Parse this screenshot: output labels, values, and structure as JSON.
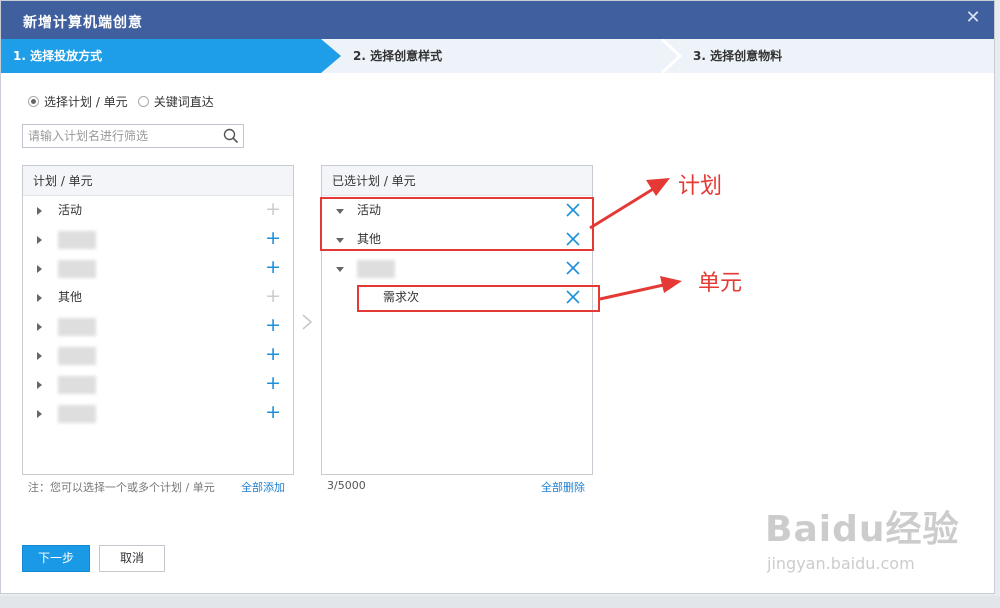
{
  "window": {
    "title": "新增计算机端创意"
  },
  "steps": [
    {
      "label": "1. 选择投放方式",
      "active": true
    },
    {
      "label": "2. 选择创意样式",
      "active": false
    },
    {
      "label": "3. 选择创意物料",
      "active": false
    }
  ],
  "mode": {
    "options": [
      {
        "label": "选择计划 / 单元",
        "selected": true
      },
      {
        "label": "关键词直达",
        "selected": false
      }
    ]
  },
  "search": {
    "placeholder": "请输入计划名进行筛选",
    "value": ""
  },
  "left_panel": {
    "header": "计划 / 单元",
    "items": [
      {
        "label": "活动",
        "blurred": false,
        "add_enabled": false
      },
      {
        "label": "",
        "blurred": true,
        "add_enabled": true
      },
      {
        "label": "",
        "blurred": true,
        "add_enabled": true
      },
      {
        "label": "其他",
        "blurred": false,
        "add_enabled": false
      },
      {
        "label": "",
        "blurred": true,
        "add_enabled": true
      },
      {
        "label": "",
        "blurred": true,
        "add_enabled": true
      },
      {
        "label": "",
        "blurred": true,
        "add_enabled": true
      },
      {
        "label": "",
        "blurred": true,
        "add_enabled": true
      }
    ],
    "note": "注：您可以选择一个或多个计划 / 单元",
    "add_all": "全部添加"
  },
  "right_panel": {
    "header": "已选计划 / 单元",
    "items": [
      {
        "label": "活动",
        "blurred": false,
        "level": 0
      },
      {
        "label": "其他",
        "blurred": false,
        "level": 0
      },
      {
        "label": "",
        "blurred": true,
        "level": 0
      },
      {
        "label": "需求次",
        "blurred": false,
        "level": 1
      }
    ],
    "count": "3/5000",
    "delete_all": "全部删除"
  },
  "buttons": {
    "next": "下一步",
    "cancel": "取消"
  },
  "annotations": {
    "plan": "计划",
    "unit": "单元"
  },
  "watermark": {
    "brand": "Baidu经验",
    "url": "jingyan.baidu.com"
  },
  "colors": {
    "titlebar": "#3f5f9e",
    "accent": "#1e9de8",
    "annotation": "#e53935"
  }
}
